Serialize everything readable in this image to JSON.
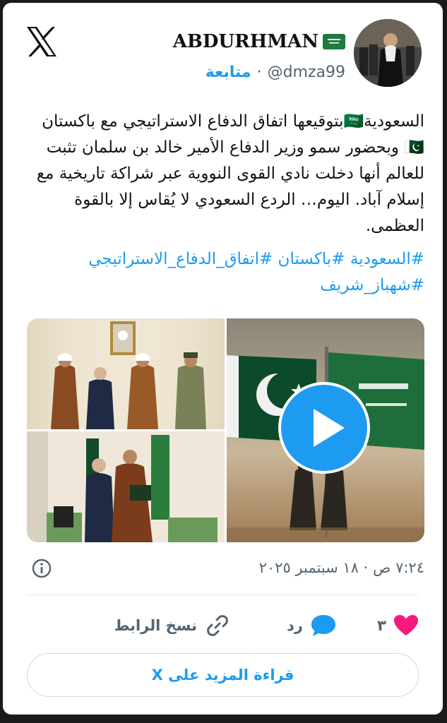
{
  "author": {
    "display_name": "ABDURHMAN",
    "handle": "@dmza99",
    "separator": "·",
    "follow_label": "متابعة"
  },
  "tweet": {
    "text": "السعودية🇸🇦بتوقيعها اتفاق الدفاع الاستراتيجي مع باكستان🇵🇰 وبحضور سمو وزير الدفاع الأمير خالد بن سلمان تثبت للعالم أنها دخلت نادي القوى النووية عبر شراكة تاريخية مع إسلام آباد. اليوم… الردع السعودي لا يُقاس إلا بالقوة العظمى.",
    "hashtags": "#السعودية #باكستان #اتفاق_الدفاع_الاستراتيجي #شهباز_شريف",
    "timestamp": "٧:٢٤ ص · ١٨ سبتمبر ٢٠٢٥"
  },
  "actions": {
    "like_count": "٣",
    "reply_label": "رد",
    "copy_link_label": "نسخ الرابط"
  },
  "read_more_label": "قراءة المزيد على X",
  "colors": {
    "accent": "#1d9bf0",
    "like": "#f91880",
    "secondary_text": "#536471",
    "saudi_green": "#1e6e3c",
    "pakistan_green": "#0b4a2a"
  },
  "icons": [
    "x-logo-icon",
    "saudi-flag-icon",
    "pakistan-flag-icon",
    "info-icon",
    "heart-icon",
    "reply-bubble-icon",
    "link-icon",
    "play-icon"
  ]
}
